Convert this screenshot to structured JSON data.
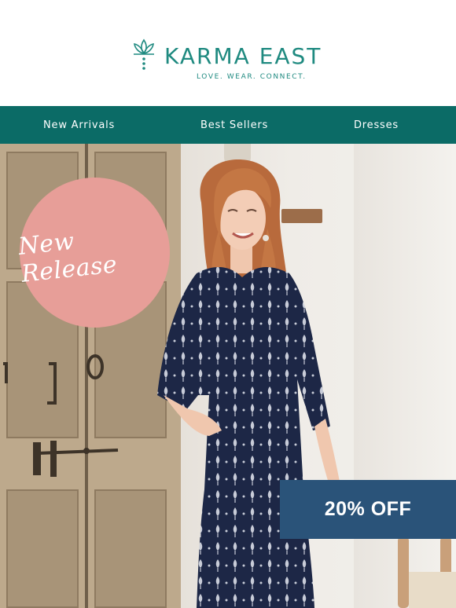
{
  "brand": {
    "name": "KARMA EAST",
    "tagline": "LOVE. WEAR. CONNECT.",
    "logo_icon": "lotus-icon",
    "color": "#1f8a80"
  },
  "nav": {
    "background": "#0b6b66",
    "items": [
      {
        "label": "New Arrivals"
      },
      {
        "label": "Best Sellers"
      },
      {
        "label": "Dresses"
      }
    ]
  },
  "hero": {
    "badge_text": "New Release",
    "badge_color": "#e79e98",
    "offer_text": "20% OFF",
    "offer_color": "#2a5379"
  }
}
